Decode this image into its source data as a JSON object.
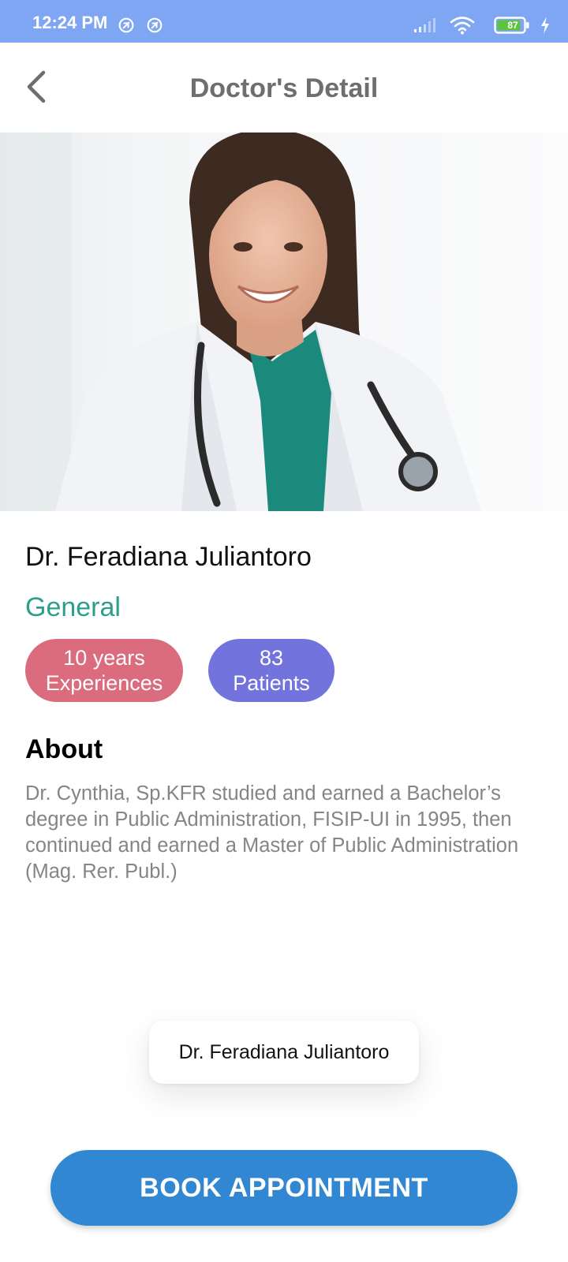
{
  "status_bar": {
    "time": "12:24 PM",
    "battery_level": "87",
    "icons": [
      "app-notification-icon",
      "app-notification-icon",
      "signal-icon",
      "wifi-icon",
      "battery-icon",
      "charging-icon"
    ],
    "background": "#7ea6f3"
  },
  "app_bar": {
    "title": "Doctor's Detail",
    "back_icon": "chevron-left-icon"
  },
  "doctor": {
    "name": "Dr. Feradiana Juliantoro",
    "specialty": "General",
    "specialty_color": "#2aa08a",
    "photo": "doctor-portrait"
  },
  "stats": {
    "experience_line1": "10 years",
    "experience_line2": "Experiences",
    "experience_color": "#da6c7e",
    "patients_line1": "83",
    "patients_line2": "Patients",
    "patients_color": "#7373dd"
  },
  "about": {
    "heading": "About",
    "text": "Dr. Cynthia, Sp.KFR studied and earned a Bachelor’s degree in Public Administration, FISIP-UI in 1995, then continued and earned a Master of Public Administration (Mag. Rer. Publ.)"
  },
  "tooltip": {
    "text": "Dr. Feradiana Juliantoro"
  },
  "actions": {
    "book_label": "BOOK APPOINTMENT",
    "book_color": "#3287d2"
  }
}
